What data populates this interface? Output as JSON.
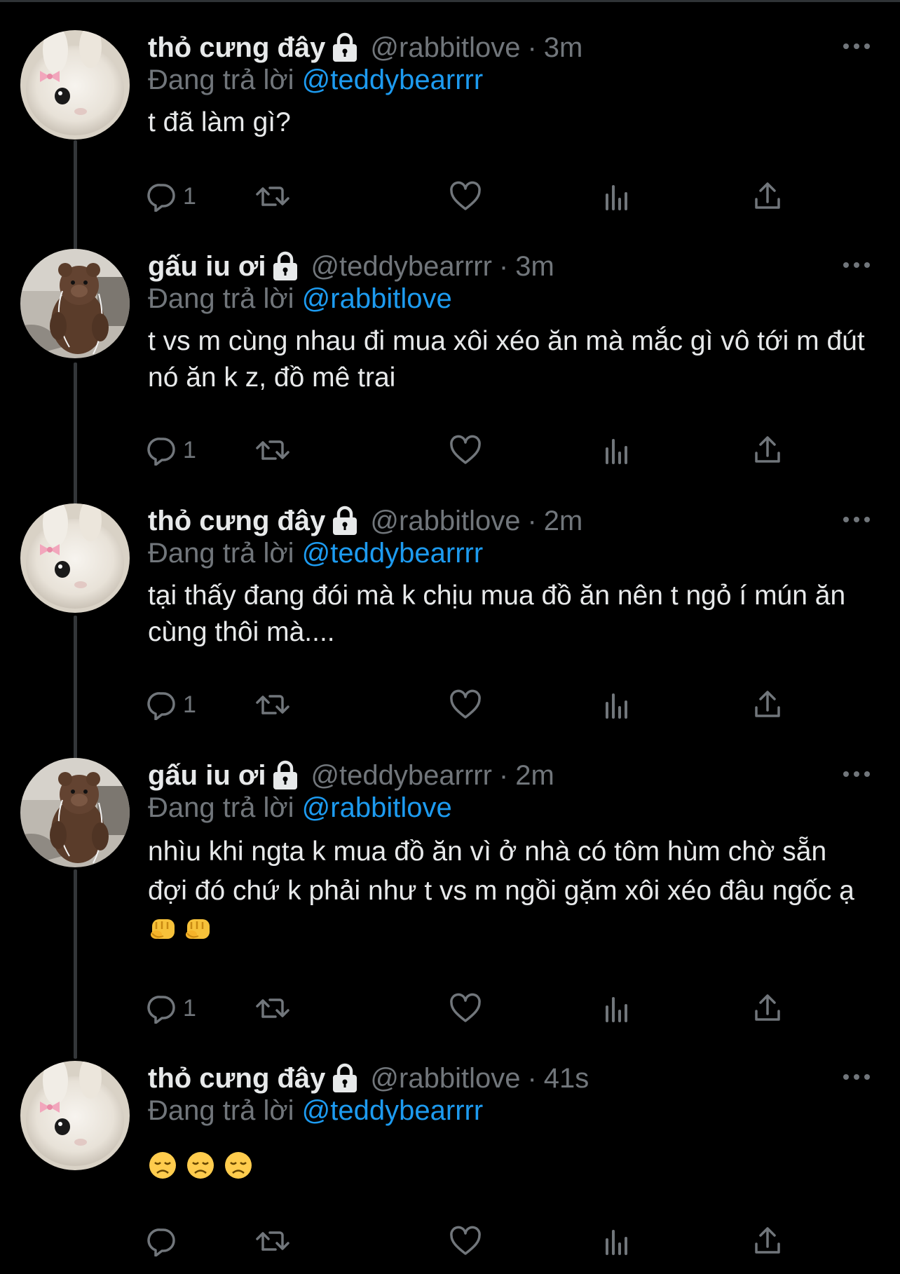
{
  "colors": {
    "background": "#000000",
    "text": "#e7e9ea",
    "secondary": "#71767b",
    "link": "#1d9bf0",
    "thread_line": "#333639"
  },
  "icons": {
    "lock": "lock-icon",
    "more": "more-icon",
    "reply": "reply-icon",
    "retweet": "retweet-icon",
    "like": "heart-icon",
    "views": "analytics-icon",
    "share": "share-icon"
  },
  "tweets": [
    {
      "name": "thỏ cưng đây",
      "handle": "@rabbitlove",
      "sep": "·",
      "time": "3m",
      "reply_prefix": "Đang trả lời",
      "reply_to": "@teddybearrrr",
      "text": "t đã làm gì?",
      "reply_count": "1",
      "avatar": "rabbit"
    },
    {
      "name": "gấu iu ơi",
      "handle": "@teddybearrrr",
      "sep": "·",
      "time": "3m",
      "reply_prefix": "Đang trả lời",
      "reply_to": "@rabbitlove",
      "text": "t vs m cùng nhau đi mua xôi xéo ăn mà mắc gì vô tới m đút nó ăn k z, đồ mê trai",
      "reply_count": "1",
      "avatar": "teddy"
    },
    {
      "name": "thỏ cưng đây",
      "handle": "@rabbitlove",
      "sep": "·",
      "time": "2m",
      "reply_prefix": "Đang trả lời",
      "reply_to": "@teddybearrrr",
      "text": "tại thấy đang đói mà k chịu mua đồ ăn nên t ngỏ í mún ăn cùng thôi mà....",
      "reply_count": "1",
      "avatar": "rabbit"
    },
    {
      "name": "gấu iu ơi",
      "handle": "@teddybearrrr",
      "sep": "·",
      "time": "2m",
      "reply_prefix": "Đang trả lời",
      "reply_to": "@rabbitlove",
      "text": "nhìu khi ngta k mua đồ ăn vì ở nhà có tôm hùm chờ sẵn đợi đó chứ k phải như t vs m ngồi gặm xôi xéo đâu ngốc ạ",
      "emoji": [
        "fist",
        "fist"
      ],
      "reply_count": "1",
      "avatar": "teddy"
    },
    {
      "name": "thỏ cưng đây",
      "handle": "@rabbitlove",
      "sep": "·",
      "time": "41s",
      "reply_prefix": "Đang trả lời",
      "reply_to": "@teddybearrrr",
      "text": "",
      "emoji": [
        "disappointed",
        "disappointed",
        "disappointed"
      ],
      "reply_count": "",
      "avatar": "rabbit"
    }
  ]
}
